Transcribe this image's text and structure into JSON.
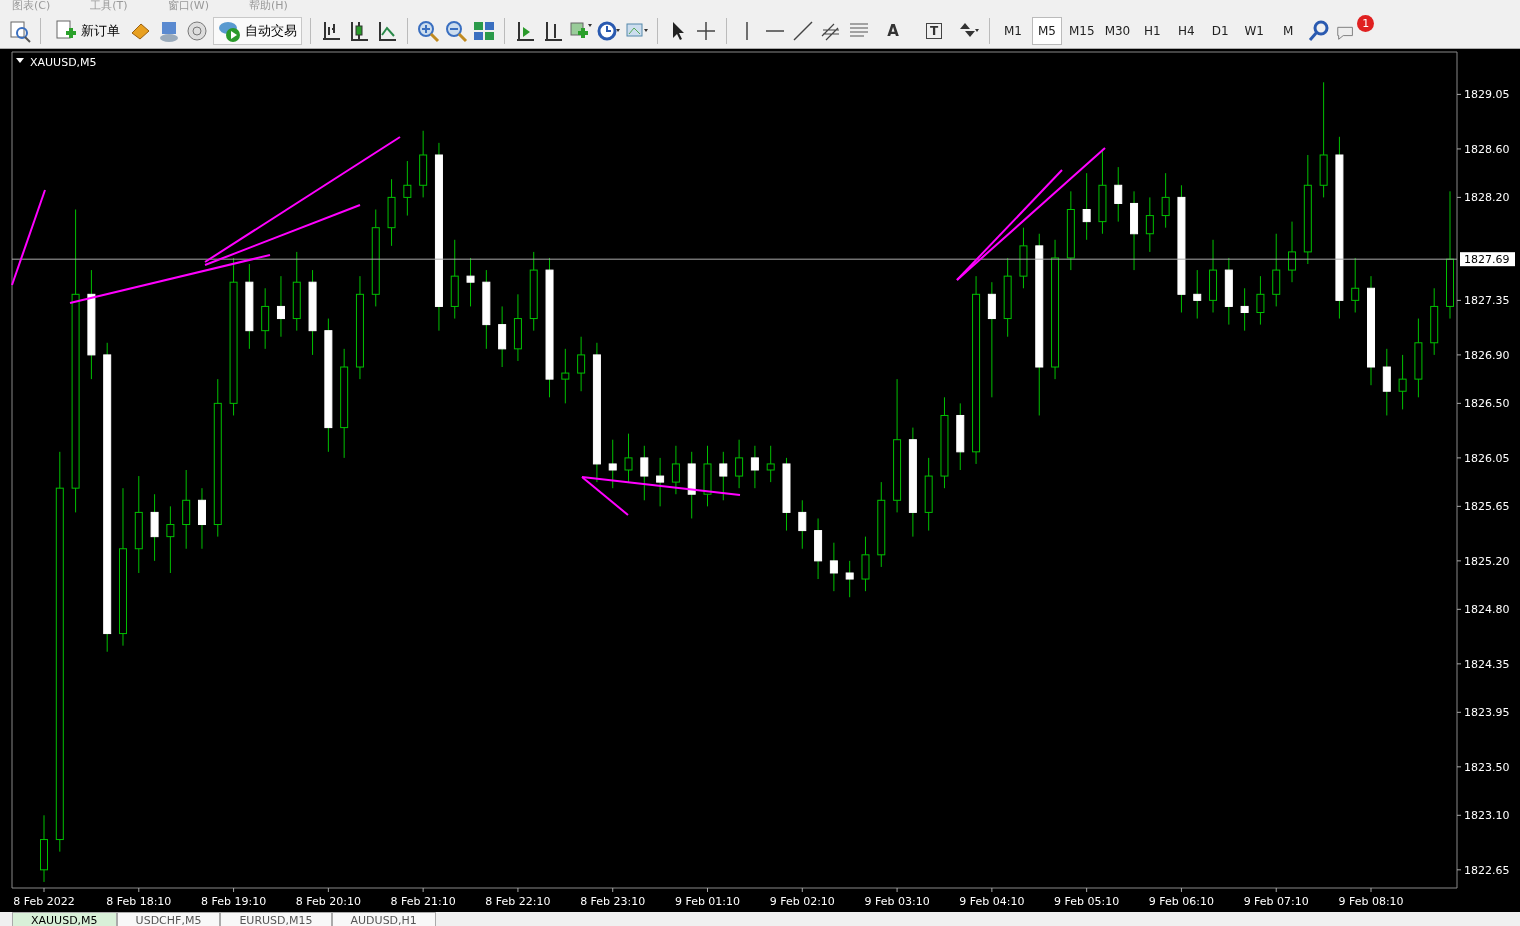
{
  "menu": [
    "图表(C)",
    "工具(T)",
    "窗口(W)",
    "帮助(H)"
  ],
  "toolbar": {
    "new_order": "新订单",
    "auto_trading": "自动交易",
    "text_tool": "A",
    "text_label_tool": "T",
    "notifications": "1",
    "timeframes": [
      {
        "label": "M1",
        "selected": false
      },
      {
        "label": "M5",
        "selected": true
      },
      {
        "label": "M15",
        "selected": false
      },
      {
        "label": "M30",
        "selected": false
      },
      {
        "label": "H1",
        "selected": false
      },
      {
        "label": "H4",
        "selected": false
      },
      {
        "label": "D1",
        "selected": false
      },
      {
        "label": "W1",
        "selected": false
      },
      {
        "label": "M",
        "selected": false
      }
    ]
  },
  "chart": {
    "title": "XAUUSD,M5",
    "current_price": "1827.69",
    "chart_data": {
      "type": "candlestick",
      "ylim": [
        1822.5,
        1829.4
      ],
      "categories": [
        "8 Feb 2022",
        null,
        null,
        null,
        null,
        null,
        "8 Feb 18:10",
        null,
        null,
        null,
        null,
        null,
        "8 Feb 19:10",
        null,
        null,
        null,
        null,
        null,
        "8 Feb 20:10",
        null,
        null,
        null,
        null,
        null,
        "8 Feb 21:10",
        null,
        null,
        null,
        null,
        null,
        "8 Feb 22:10",
        null,
        null,
        null,
        null,
        null,
        "8 Feb 23:10",
        null,
        null,
        null,
        null,
        null,
        "9 Feb 01:10",
        null,
        null,
        null,
        null,
        null,
        "9 Feb 02:10",
        null,
        null,
        null,
        null,
        null,
        "9 Feb 03:10",
        null,
        null,
        null,
        null,
        null,
        "9 Feb 04:10",
        null,
        null,
        null,
        null,
        null,
        "9 Feb 05:10",
        null,
        null,
        null,
        null,
        null,
        "9 Feb 06:10",
        null,
        null,
        null,
        null,
        null,
        "9 Feb 07:10",
        null,
        null,
        null,
        null,
        null,
        "9 Feb 08:10",
        null,
        null,
        null,
        null,
        null
      ],
      "ohlc": [
        [
          1822.65,
          1823.1,
          1822.55,
          1822.9
        ],
        [
          1822.9,
          1826.1,
          1822.8,
          1825.8
        ],
        [
          1825.8,
          1828.1,
          1825.6,
          1827.4
        ],
        [
          1827.4,
          1827.6,
          1826.7,
          1826.9
        ],
        [
          1826.9,
          1827.0,
          1824.45,
          1824.6
        ],
        [
          1824.6,
          1825.8,
          1824.5,
          1825.3
        ],
        [
          1825.3,
          1825.9,
          1825.1,
          1825.6
        ],
        [
          1825.6,
          1825.75,
          1825.2,
          1825.4
        ],
        [
          1825.4,
          1825.65,
          1825.1,
          1825.5
        ],
        [
          1825.5,
          1825.95,
          1825.3,
          1825.7
        ],
        [
          1825.7,
          1825.8,
          1825.3,
          1825.5
        ],
        [
          1825.5,
          1826.7,
          1825.4,
          1826.5
        ],
        [
          1826.5,
          1827.7,
          1826.4,
          1827.5
        ],
        [
          1827.5,
          1827.65,
          1826.95,
          1827.1
        ],
        [
          1827.1,
          1827.45,
          1826.95,
          1827.3
        ],
        [
          1827.3,
          1827.55,
          1827.05,
          1827.2
        ],
        [
          1827.2,
          1827.75,
          1827.1,
          1827.5
        ],
        [
          1827.5,
          1827.6,
          1826.9,
          1827.1
        ],
        [
          1827.1,
          1827.2,
          1826.1,
          1826.3
        ],
        [
          1826.3,
          1826.95,
          1826.05,
          1826.8
        ],
        [
          1826.8,
          1827.55,
          1826.7,
          1827.4
        ],
        [
          1827.4,
          1828.1,
          1827.3,
          1827.95
        ],
        [
          1827.95,
          1828.35,
          1827.8,
          1828.2
        ],
        [
          1828.2,
          1828.5,
          1828.05,
          1828.3
        ],
        [
          1828.3,
          1828.75,
          1828.2,
          1828.55
        ],
        [
          1828.55,
          1828.65,
          1827.1,
          1827.3
        ],
        [
          1827.3,
          1827.85,
          1827.2,
          1827.55
        ],
        [
          1827.55,
          1827.7,
          1827.3,
          1827.5
        ],
        [
          1827.5,
          1827.6,
          1826.95,
          1827.15
        ],
        [
          1827.15,
          1827.3,
          1826.8,
          1826.95
        ],
        [
          1826.95,
          1827.4,
          1826.85,
          1827.2
        ],
        [
          1827.2,
          1827.75,
          1827.1,
          1827.6
        ],
        [
          1827.6,
          1827.7,
          1826.55,
          1826.7
        ],
        [
          1826.7,
          1826.95,
          1826.5,
          1826.75
        ],
        [
          1826.75,
          1827.05,
          1826.6,
          1826.9
        ],
        [
          1826.9,
          1827.0,
          1825.85,
          1826.0
        ],
        [
          1826.0,
          1826.2,
          1825.8,
          1825.95
        ],
        [
          1825.95,
          1826.25,
          1825.85,
          1826.05
        ],
        [
          1826.05,
          1826.15,
          1825.7,
          1825.9
        ],
        [
          1825.9,
          1826.05,
          1825.65,
          1825.85
        ],
        [
          1825.85,
          1826.15,
          1825.75,
          1826.0
        ],
        [
          1826.0,
          1826.1,
          1825.55,
          1825.75
        ],
        [
          1825.75,
          1826.15,
          1825.65,
          1826.0
        ],
        [
          1826.0,
          1826.1,
          1825.7,
          1825.9
        ],
        [
          1825.9,
          1826.2,
          1825.8,
          1826.05
        ],
        [
          1826.05,
          1826.15,
          1825.8,
          1825.95
        ],
        [
          1825.95,
          1826.15,
          1825.85,
          1826.0
        ],
        [
          1826.0,
          1826.05,
          1825.45,
          1825.6
        ],
        [
          1825.6,
          1825.7,
          1825.3,
          1825.45
        ],
        [
          1825.45,
          1825.55,
          1825.05,
          1825.2
        ],
        [
          1825.2,
          1825.35,
          1824.95,
          1825.1
        ],
        [
          1825.1,
          1825.2,
          1824.9,
          1825.05
        ],
        [
          1825.05,
          1825.4,
          1824.95,
          1825.25
        ],
        [
          1825.25,
          1825.85,
          1825.15,
          1825.7
        ],
        [
          1825.7,
          1826.7,
          1825.6,
          1826.2
        ],
        [
          1826.2,
          1826.3,
          1825.4,
          1825.6
        ],
        [
          1825.6,
          1826.05,
          1825.45,
          1825.9
        ],
        [
          1825.9,
          1826.55,
          1825.8,
          1826.4
        ],
        [
          1826.4,
          1826.5,
          1825.95,
          1826.1
        ],
        [
          1826.1,
          1827.55,
          1826.0,
          1827.4
        ],
        [
          1827.4,
          1827.5,
          1826.55,
          1827.2
        ],
        [
          1827.2,
          1827.7,
          1827.05,
          1827.55
        ],
        [
          1827.55,
          1827.95,
          1827.45,
          1827.8
        ],
        [
          1827.8,
          1827.9,
          1826.4,
          1826.8
        ],
        [
          1826.8,
          1827.85,
          1826.7,
          1827.7
        ],
        [
          1827.7,
          1828.25,
          1827.6,
          1828.1
        ],
        [
          1828.1,
          1828.4,
          1827.85,
          1828.0
        ],
        [
          1828.0,
          1828.6,
          1827.9,
          1828.3
        ],
        [
          1828.3,
          1828.45,
          1828.0,
          1828.15
        ],
        [
          1828.15,
          1828.25,
          1827.6,
          1827.9
        ],
        [
          1827.9,
          1828.2,
          1827.75,
          1828.05
        ],
        [
          1828.05,
          1828.4,
          1827.95,
          1828.2
        ],
        [
          1828.2,
          1828.3,
          1827.25,
          1827.4
        ],
        [
          1827.4,
          1827.6,
          1827.2,
          1827.35
        ],
        [
          1827.35,
          1827.85,
          1827.25,
          1827.6
        ],
        [
          1827.6,
          1827.7,
          1827.15,
          1827.3
        ],
        [
          1827.3,
          1827.45,
          1827.1,
          1827.25
        ],
        [
          1827.25,
          1827.55,
          1827.15,
          1827.4
        ],
        [
          1827.4,
          1827.9,
          1827.3,
          1827.6
        ],
        [
          1827.6,
          1828.0,
          1827.5,
          1827.75
        ],
        [
          1827.75,
          1828.55,
          1827.65,
          1828.3
        ],
        [
          1828.3,
          1829.15,
          1828.2,
          1828.55
        ],
        [
          1828.55,
          1828.7,
          1827.2,
          1827.35
        ],
        [
          1827.35,
          1827.7,
          1827.25,
          1827.45
        ],
        [
          1827.45,
          1827.55,
          1826.65,
          1826.8
        ],
        [
          1826.8,
          1826.95,
          1826.4,
          1826.6
        ],
        [
          1826.6,
          1826.9,
          1826.45,
          1826.7
        ],
        [
          1826.7,
          1827.2,
          1826.55,
          1827.0
        ],
        [
          1827.0,
          1827.45,
          1826.9,
          1827.3
        ],
        [
          1827.3,
          1828.25,
          1827.2,
          1827.69
        ]
      ],
      "yticks": [
        {
          "value": 1829.05,
          "label": "1829.05"
        },
        {
          "value": 1828.6,
          "label": "1828.60"
        },
        {
          "value": 1828.2,
          "label": "1828.20"
        },
        {
          "value": 1827.35,
          "label": "1827.35"
        },
        {
          "value": 1826.9,
          "label": "1826.90"
        },
        {
          "value": 1826.5,
          "label": "1826.50"
        },
        {
          "value": 1826.05,
          "label": "1826.05"
        },
        {
          "value": 1825.65,
          "label": "1825.65"
        },
        {
          "value": 1825.2,
          "label": "1825.20"
        },
        {
          "value": 1824.8,
          "label": "1824.80"
        },
        {
          "value": 1824.35,
          "label": "1824.35"
        },
        {
          "value": 1823.95,
          "label": "1823.95"
        },
        {
          "value": 1823.5,
          "label": "1823.50"
        },
        {
          "value": 1823.1,
          "label": "1823.10"
        },
        {
          "value": 1822.65,
          "label": "1822.65"
        }
      ]
    }
  },
  "tabs": [
    {
      "label": "XAUUSD,M5",
      "selected": true
    },
    {
      "label": "USDCHF,M5",
      "selected": false
    },
    {
      "label": "EURUSD,M15",
      "selected": false
    },
    {
      "label": "AUDUSD,H1",
      "selected": false
    }
  ]
}
